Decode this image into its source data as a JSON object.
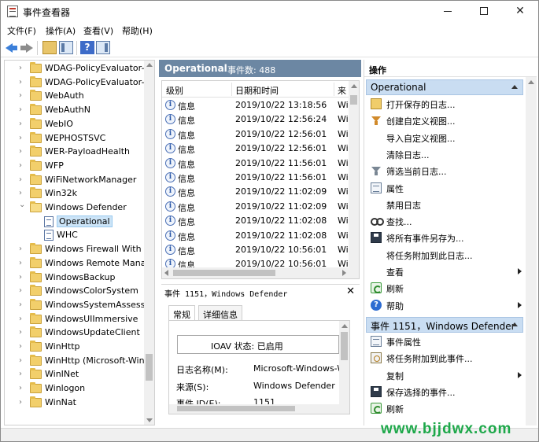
{
  "window": {
    "title": "事件查看器"
  },
  "menu": [
    "文件(F)",
    "操作(A)",
    "查看(V)",
    "帮助(H)"
  ],
  "toolbar": {
    "icons": [
      "back-icon",
      "forward-icon",
      "open-folder-icon",
      "show-hide-tree-icon",
      "help-icon",
      "show-hide-action-pane-icon"
    ]
  },
  "tree": {
    "items": [
      {
        "label": "WDAG-PolicyEvaluator-CS",
        "type": "folder"
      },
      {
        "label": "WDAG-PolicyEvaluator-GI",
        "type": "folder"
      },
      {
        "label": "WebAuth",
        "type": "folder"
      },
      {
        "label": "WebAuthN",
        "type": "folder"
      },
      {
        "label": "WebIO",
        "type": "folder"
      },
      {
        "label": "WEPHOSTSVC",
        "type": "folder"
      },
      {
        "label": "WER-PayloadHealth",
        "type": "folder"
      },
      {
        "label": "WFP",
        "type": "folder"
      },
      {
        "label": "WiFiNetworkManager",
        "type": "folder"
      },
      {
        "label": "Win32k",
        "type": "folder"
      },
      {
        "label": "Windows Defender",
        "type": "folder-open"
      },
      {
        "label": "Operational",
        "type": "log",
        "selected": true
      },
      {
        "label": "WHC",
        "type": "log"
      },
      {
        "label": "Windows Firewall With Ad",
        "type": "folder"
      },
      {
        "label": "Windows Remote Manag",
        "type": "folder"
      },
      {
        "label": "WindowsBackup",
        "type": "folder"
      },
      {
        "label": "WindowsColorSystem",
        "type": "folder"
      },
      {
        "label": "WindowsSystemAssessm",
        "type": "folder"
      },
      {
        "label": "WindowsUIImmersive",
        "type": "folder"
      },
      {
        "label": "WindowsUpdateClient",
        "type": "folder"
      },
      {
        "label": "WinHttp",
        "type": "folder"
      },
      {
        "label": "WinHttp (Microsoft-Wind",
        "type": "folder"
      },
      {
        "label": "WinINet",
        "type": "folder"
      },
      {
        "label": "Winlogon",
        "type": "folder"
      },
      {
        "label": "WinNat",
        "type": "folder"
      }
    ]
  },
  "events": {
    "log_name": "Operational",
    "count_label": "事件数: 488",
    "columns": [
      "级别",
      "日期和时间",
      "来"
    ],
    "rows": [
      {
        "level": "信息",
        "datetime": "2019/10/22 13:18:56",
        "source": "Wi"
      },
      {
        "level": "信息",
        "datetime": "2019/10/22 12:56:24",
        "source": "Wi"
      },
      {
        "level": "信息",
        "datetime": "2019/10/22 12:56:01",
        "source": "Wi"
      },
      {
        "level": "信息",
        "datetime": "2019/10/22 12:56:01",
        "source": "Wi"
      },
      {
        "level": "信息",
        "datetime": "2019/10/22 11:56:01",
        "source": "Wi"
      },
      {
        "level": "信息",
        "datetime": "2019/10/22 11:56:01",
        "source": "Wi"
      },
      {
        "level": "信息",
        "datetime": "2019/10/22 11:02:09",
        "source": "Wi"
      },
      {
        "level": "信息",
        "datetime": "2019/10/22 11:02:09",
        "source": "Wi"
      },
      {
        "level": "信息",
        "datetime": "2019/10/22 11:02:08",
        "source": "Wi"
      },
      {
        "level": "信息",
        "datetime": "2019/10/22 11:02:08",
        "source": "Wi"
      },
      {
        "level": "信息",
        "datetime": "2019/10/22 10:56:01",
        "source": "Wi"
      },
      {
        "level": "信息",
        "datetime": "2019/10/22 10:56:01",
        "source": "Wi"
      }
    ]
  },
  "detail": {
    "title": "事件 1151，Windows Defender",
    "tabs": [
      "常规",
      "详细信息"
    ],
    "status_text": "IOAV 状态: 已启用",
    "fields": [
      {
        "label": "日志名称(M):",
        "value": "Microsoft-Windows-W"
      },
      {
        "label": "来源(S):",
        "value": "Windows Defender"
      },
      {
        "label": "事件 ID(E):",
        "value": "1151"
      }
    ]
  },
  "actions": {
    "title": "操作",
    "section1": "Operational",
    "items1": [
      {
        "label": "打开保存的日志...",
        "icon": "open-log-icon"
      },
      {
        "label": "创建自定义视图...",
        "icon": "filter-icon"
      },
      {
        "label": "导入自定义视图...",
        "icon": ""
      },
      {
        "label": "清除日志...",
        "icon": ""
      },
      {
        "label": "筛选当前日志...",
        "icon": "filter-gray-icon"
      },
      {
        "label": "属性",
        "icon": "properties-icon"
      },
      {
        "label": "禁用日志",
        "icon": ""
      },
      {
        "label": "查找...",
        "icon": "find-icon"
      },
      {
        "label": "将所有事件另存为...",
        "icon": "save-icon"
      },
      {
        "label": "将任务附加到此日志...",
        "icon": ""
      },
      {
        "label": "查看",
        "icon": "",
        "submenu": true
      },
      {
        "label": "刷新",
        "icon": "refresh-icon"
      },
      {
        "label": "帮助",
        "icon": "help-icon",
        "submenu": true
      }
    ],
    "section2": "事件 1151，Windows Defender",
    "items2": [
      {
        "label": "事件属性",
        "icon": "properties-icon"
      },
      {
        "label": "将任务附加到此事件...",
        "icon": "attach-task-icon"
      },
      {
        "label": "复制",
        "icon": "",
        "submenu": true
      },
      {
        "label": "保存选择的事件...",
        "icon": "save-icon"
      },
      {
        "label": "刷新",
        "icon": "refresh-icon"
      }
    ]
  },
  "watermark": "www.bjjdwx.com"
}
